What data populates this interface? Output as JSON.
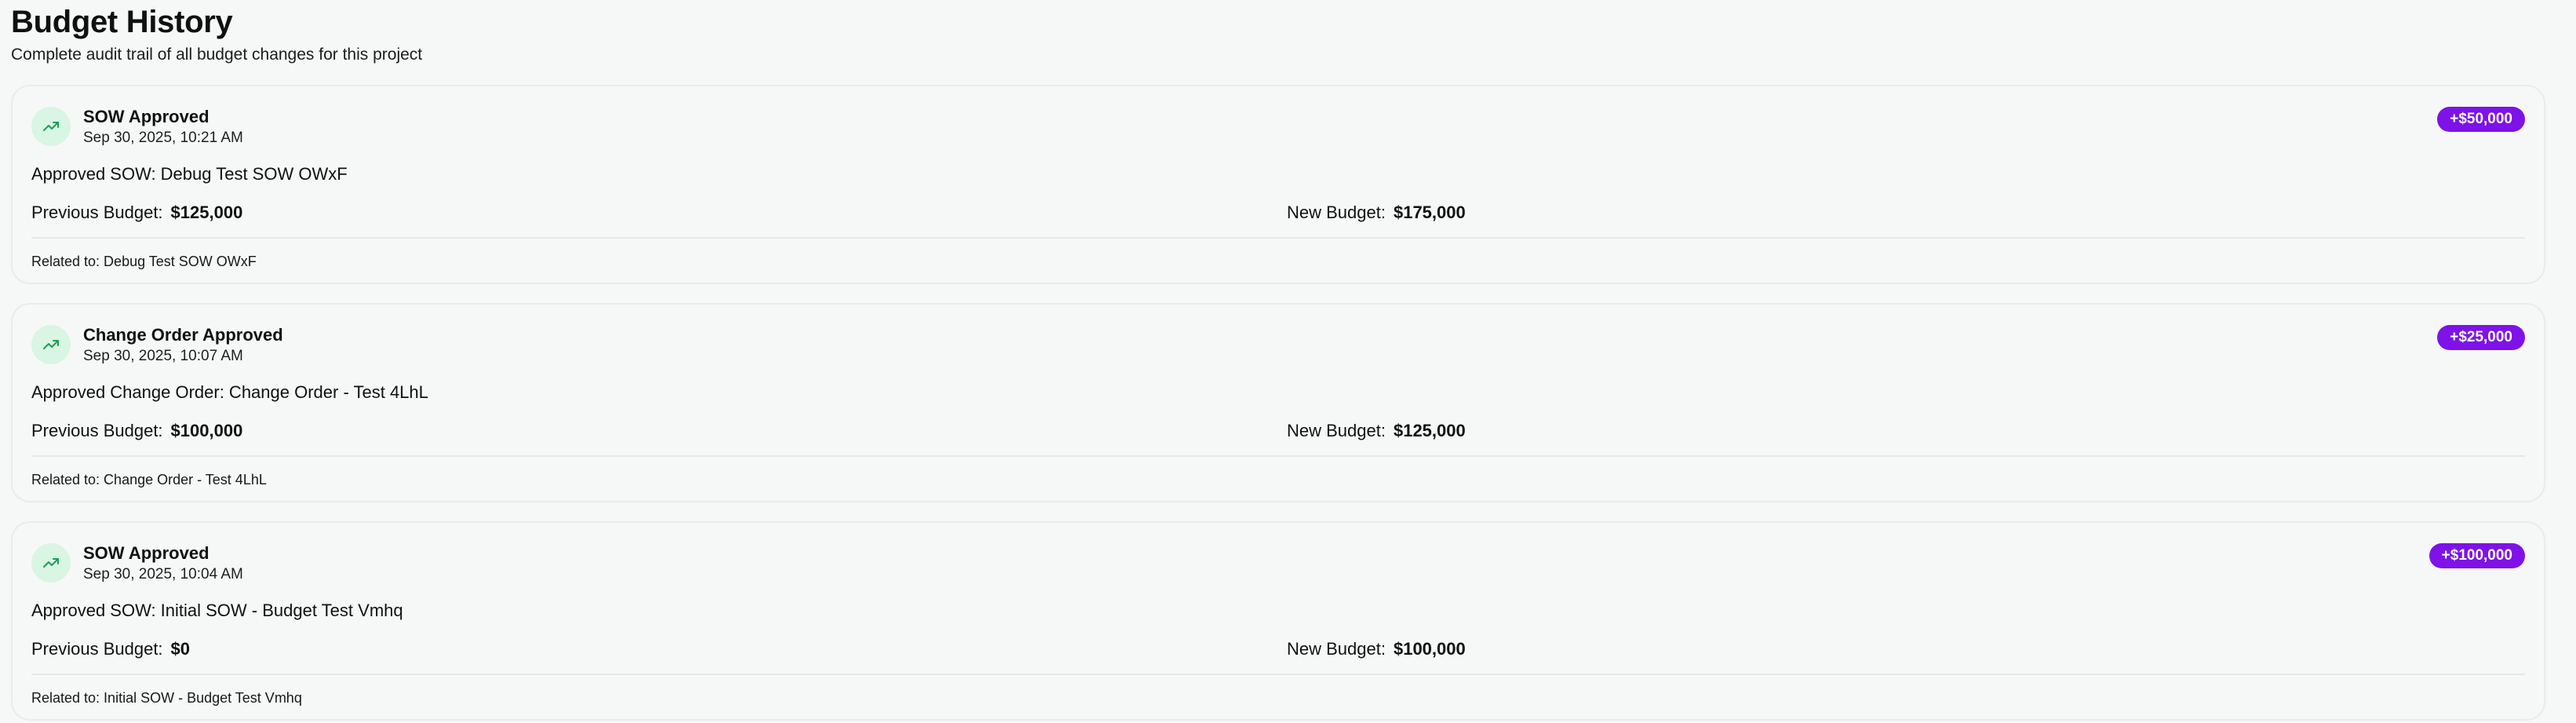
{
  "page": {
    "title": "Budget History",
    "subtitle": "Complete audit trail of all budget changes for this project"
  },
  "colors": {
    "background": "#f6f8f7",
    "badge": "#7e12e8",
    "icon_bg": "#d9f5e3",
    "icon_stroke": "#1f9d55"
  },
  "entries": [
    {
      "icon": "trending-up-icon",
      "title": "SOW Approved",
      "time": "Sep 30, 2025, 10:21 AM",
      "delta": "+$50,000",
      "description": "Approved SOW: Debug Test SOW OWxF",
      "previous_label": "Previous Budget:",
      "previous_value": "$125,000",
      "new_label": "New Budget:",
      "new_value": "$175,000",
      "related": "Related to: Debug Test SOW OWxF"
    },
    {
      "icon": "trending-up-icon",
      "title": "Change Order Approved",
      "time": "Sep 30, 2025, 10:07 AM",
      "delta": "+$25,000",
      "description": "Approved Change Order: Change Order - Test 4LhL",
      "previous_label": "Previous Budget:",
      "previous_value": "$100,000",
      "new_label": "New Budget:",
      "new_value": "$125,000",
      "related": "Related to: Change Order - Test 4LhL"
    },
    {
      "icon": "trending-up-icon",
      "title": "SOW Approved",
      "time": "Sep 30, 2025, 10:04 AM",
      "delta": "+$100,000",
      "description": "Approved SOW: Initial SOW - Budget Test Vmhq",
      "previous_label": "Previous Budget:",
      "previous_value": "$0",
      "new_label": "New Budget:",
      "new_value": "$100,000",
      "related": "Related to: Initial SOW - Budget Test Vmhq"
    }
  ]
}
